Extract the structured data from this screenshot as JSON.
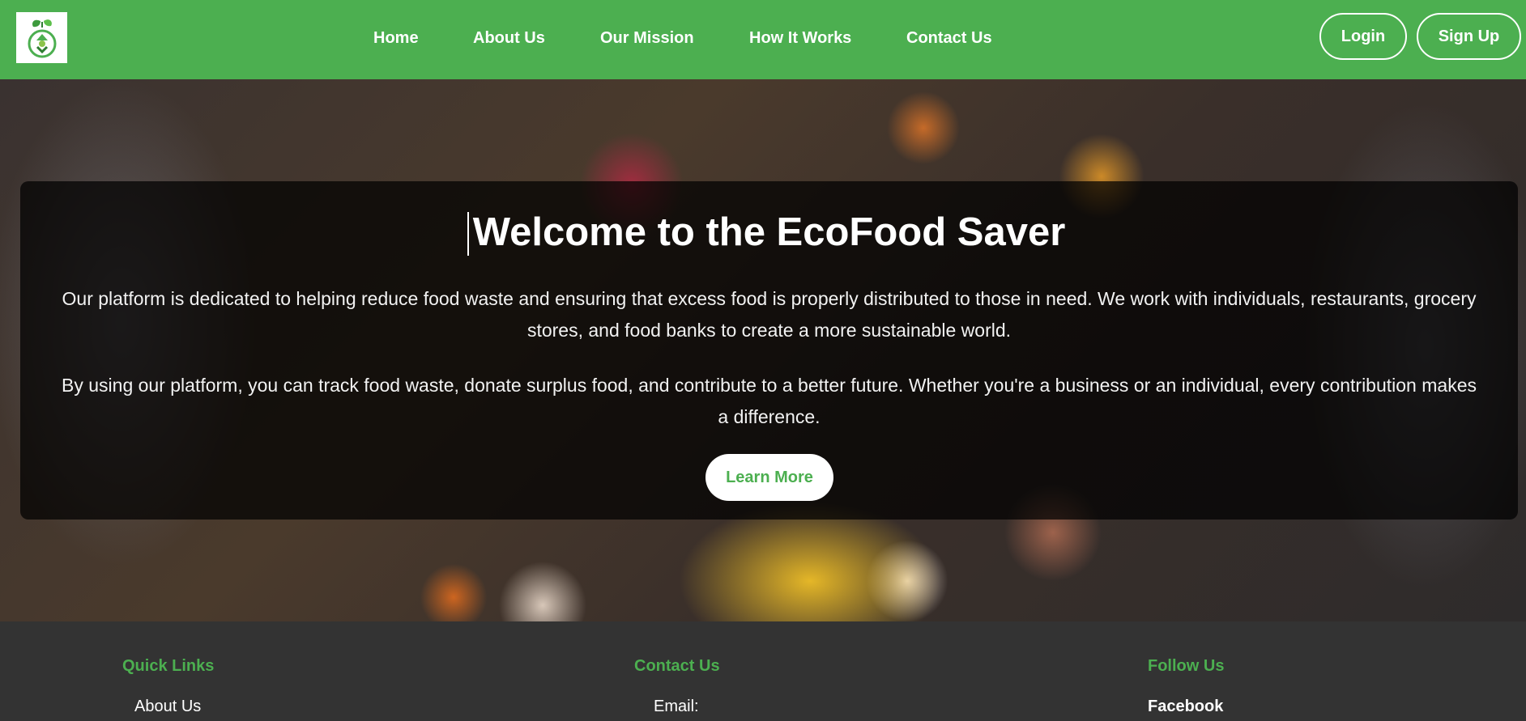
{
  "header": {
    "logo_icon": "recycle-leaf-icon",
    "brand_color": "#4caf50",
    "nav": {
      "home": "Home",
      "about": "About Us",
      "mission": "Our Mission",
      "how": "How It Works",
      "contact": "Contact Us"
    },
    "login": "Login",
    "signup": "Sign Up"
  },
  "hero": {
    "title": "Welcome to the EcoFood Saver",
    "paragraph1": "Our platform is dedicated to helping reduce food waste and ensuring that excess food is properly distributed to those in need. We work with individuals, restaurants, grocery stores, and food banks to create a more sustainable world.",
    "paragraph2": "By using our platform, you can track food waste, donate surplus food, and contribute to a better future. Whether you're a business or an individual, every contribution makes a difference.",
    "cta": "Learn More"
  },
  "footer": {
    "quick_links_title": "Quick Links",
    "quick_links_first": "About Us",
    "contact_title": "Contact Us",
    "contact_email_label": "Email:",
    "follow_title": "Follow Us",
    "follow_first": "Facebook"
  }
}
